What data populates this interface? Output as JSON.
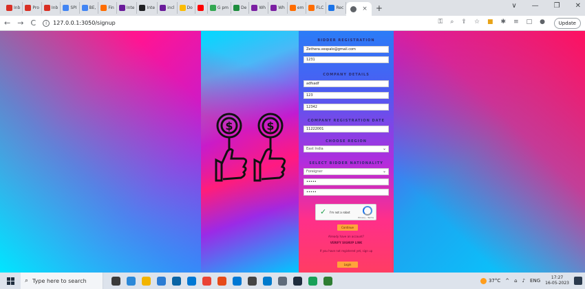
{
  "browser": {
    "tabs": [
      {
        "label": "Inb",
        "color": "#d93025"
      },
      {
        "label": "Pro",
        "color": "#d93025"
      },
      {
        "label": "Inb",
        "color": "#d93025"
      },
      {
        "label": "SPI",
        "color": "#4285f4"
      },
      {
        "label": "BE,",
        "color": "#4285f4"
      },
      {
        "label": "Fin",
        "color": "#ff6d00"
      },
      {
        "label": "Inte",
        "color": "#6a1b9a"
      },
      {
        "label": "Inte",
        "color": "#202124"
      },
      {
        "label": "incl",
        "color": "#6a1b9a"
      },
      {
        "label": "Do",
        "color": "#fbbc04"
      },
      {
        "label": "",
        "color": "#ff0000"
      },
      {
        "label": "G pm",
        "color": "#34a853"
      },
      {
        "label": "De",
        "color": "#1e8e3e"
      },
      {
        "label": "Wh",
        "color": "#7b1fa2"
      },
      {
        "label": "Wh",
        "color": "#7b1fa2"
      },
      {
        "label": "em",
        "color": "#ff6d00"
      },
      {
        "label": "FLC",
        "color": "#ff6d00"
      },
      {
        "label": "Rec",
        "color": "#1a73e8"
      }
    ],
    "active_tab_close": "×",
    "new_tab": "+",
    "window_controls": [
      "∨",
      "—",
      "❐",
      "✕"
    ],
    "url": "127.0.0.1:3050/signup",
    "update_label": "Update"
  },
  "form": {
    "bidder_registration": "BIDDER REGISTRATION",
    "email_value": "Zethera.vespalo@gmail.com",
    "phone_value": "1231",
    "company_details": "COMPANY DETAILS",
    "company_name_value": "adfsadf",
    "company_field2_value": "123",
    "company_field3_value": "12342",
    "company_registration_date": "COMPANY REGISTRATION DATE",
    "registration_date_value": "11222001",
    "choose_region": "CHOOSE REGION",
    "region_value": "East India",
    "select_bidder_nationality": "SELECT BIDDER NATIONALITY",
    "nationality_value": "Foreigner",
    "password_value": "•••••",
    "confirm_password_value": "•••••",
    "captcha_label": "I'm not a robot",
    "captcha_terms": "Privacy - Terms",
    "continue_label": "Continue",
    "note_line1": "Already have an account?",
    "note_line2": "VERIFY SIGNUP LINK",
    "note_line3": "If you have not registered yet, sign up",
    "login_label": "Login"
  },
  "taskbar": {
    "search_placeholder": "Type here to search",
    "weather": "37°C",
    "language": "ENG",
    "time": "17:27",
    "date": "16-05-2023",
    "pins": [
      "#3a3a3a",
      "#2b88d8",
      "#f2b400",
      "#2b7cd3",
      "#0a64a4",
      "#0078d4",
      "#ea4335",
      "#e64a19",
      "#0078d4",
      "#444",
      "#007acc",
      "#5f6b7a",
      "#1f2d3d",
      "#18a058",
      "#2e7d32"
    ]
  }
}
